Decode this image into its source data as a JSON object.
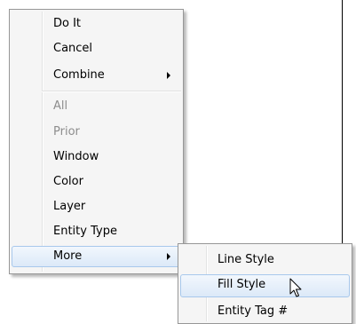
{
  "context_menu": {
    "items": [
      {
        "label": "Do It"
      },
      {
        "label": "Cancel"
      },
      {
        "label": "Combine"
      },
      {
        "label": "All"
      },
      {
        "label": "Prior"
      },
      {
        "label": "Window"
      },
      {
        "label": "Color"
      },
      {
        "label": "Layer"
      },
      {
        "label": "Entity Type"
      },
      {
        "label": "More"
      }
    ]
  },
  "submenu": {
    "items": [
      {
        "label": "Line Style"
      },
      {
        "label": "Fill Style"
      },
      {
        "label": "Entity Tag #"
      }
    ]
  },
  "colors": {
    "menu_background": "#f5f5f5",
    "menu_border": "#979797",
    "highlight_border": "#a8c8ec",
    "disabled_text": "#8d8d8d"
  },
  "icons": [
    "submenu-arrow-icon",
    "mouse-pointer-icon"
  ]
}
